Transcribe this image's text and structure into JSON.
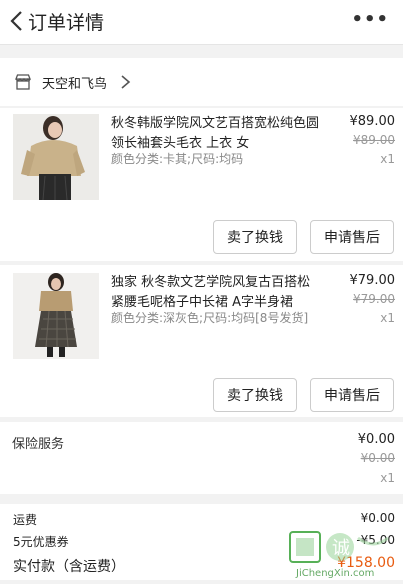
{
  "header": {
    "title": "订单详情",
    "more_label": "•••"
  },
  "shop": {
    "name": "天空和飞鸟"
  },
  "items": [
    {
      "name": "秋冬韩版学院风文艺百搭宽松纯色圆领长袖套头毛衣 上衣 女",
      "spec": "颜色分类:卡其;尺码:均码",
      "price": "¥89.00",
      "original_price": "¥89.00",
      "qty": "x1",
      "buttons": [
        "卖了换钱",
        "申请售后"
      ]
    },
    {
      "name": "独家 秋冬款文艺学院风复古百搭松紧腰毛呢格子中长裙 A字半身裙",
      "spec": "颜色分类:深灰色;尺码:均码[8号发货]",
      "price": "¥79.00",
      "original_price": "¥79.00",
      "qty": "x1",
      "buttons": [
        "卖了换钱",
        "申请售后"
      ]
    }
  ],
  "insurance": {
    "label": "保险服务",
    "price": "¥0.00",
    "original_price": "¥0.00",
    "qty": "x1"
  },
  "summary": {
    "shipping_label": "运费",
    "shipping_value": "¥0.00",
    "coupon_label": "5元优惠券",
    "coupon_value": "-¥5.00",
    "total_label": "实付款（含运费）",
    "total_value": "¥158.00"
  },
  "watermark": {
    "text": "诚",
    "site": "JiChengXin.com"
  },
  "colors": {
    "accent": "#e85b10",
    "background": "#f2f2f2"
  }
}
